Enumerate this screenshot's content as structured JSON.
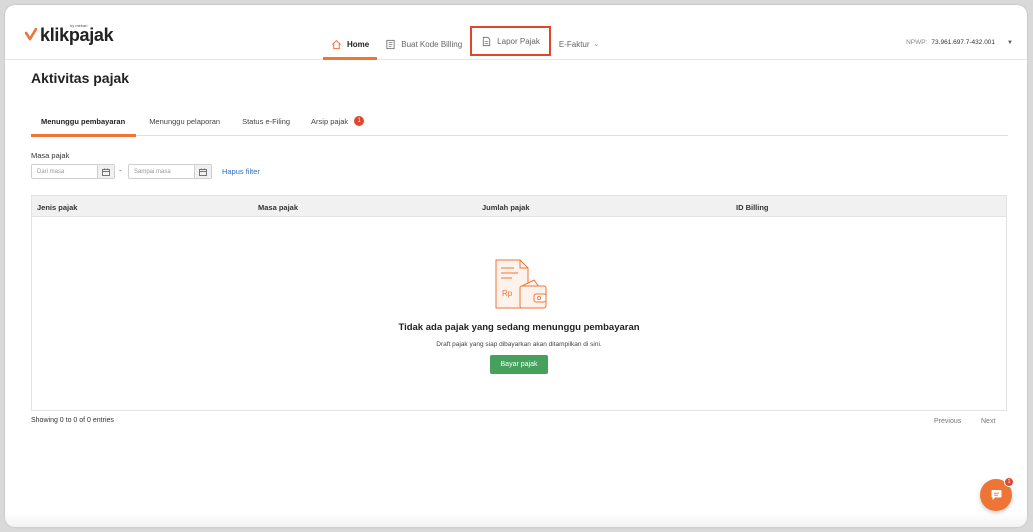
{
  "header": {
    "logo_text": "klikpajak",
    "logo_sub": "by mekari",
    "nav": [
      {
        "label": "Home"
      },
      {
        "label": "Buat Kode Billing"
      },
      {
        "label": "Lapor Pajak"
      },
      {
        "label": "E-Faktur"
      }
    ],
    "npwp_label": "NPWP:",
    "npwp_value": "73.961.697.7-432.001"
  },
  "page_title": "Aktivitas pajak",
  "tabs": [
    {
      "label": "Menunggu pembayaran"
    },
    {
      "label": "Menunggu pelaporan"
    },
    {
      "label": "Status e-Filing"
    },
    {
      "label": "Arsip pajak",
      "badge": "1"
    }
  ],
  "filter": {
    "label": "Masa pajak",
    "from_placeholder": "Dari masa",
    "to_placeholder": "Sampai masa",
    "separator": "-",
    "clear_label": "Hapus filter"
  },
  "table": {
    "columns": [
      "Jenis pajak",
      "Masa pajak",
      "Jumlah pajak",
      "ID Billing"
    ],
    "empty_title": "Tidak ada pajak yang sedang menunggu pembayaran",
    "empty_subtitle": "Draft pajak yang siap dibayarkan akan ditampilkan di sini.",
    "empty_button": "Bayar pajak",
    "empty_illustration_text": "Rp"
  },
  "footer": {
    "entries_text": "Showing 0 to 0 of 0 entries",
    "previous": "Previous",
    "next": "Next"
  },
  "chat": {
    "badge": "1"
  },
  "colors": {
    "accent": "#ee7536",
    "highlight_border": "#e0462c",
    "primary_button": "#45a15b",
    "link": "#2b6cc4"
  }
}
